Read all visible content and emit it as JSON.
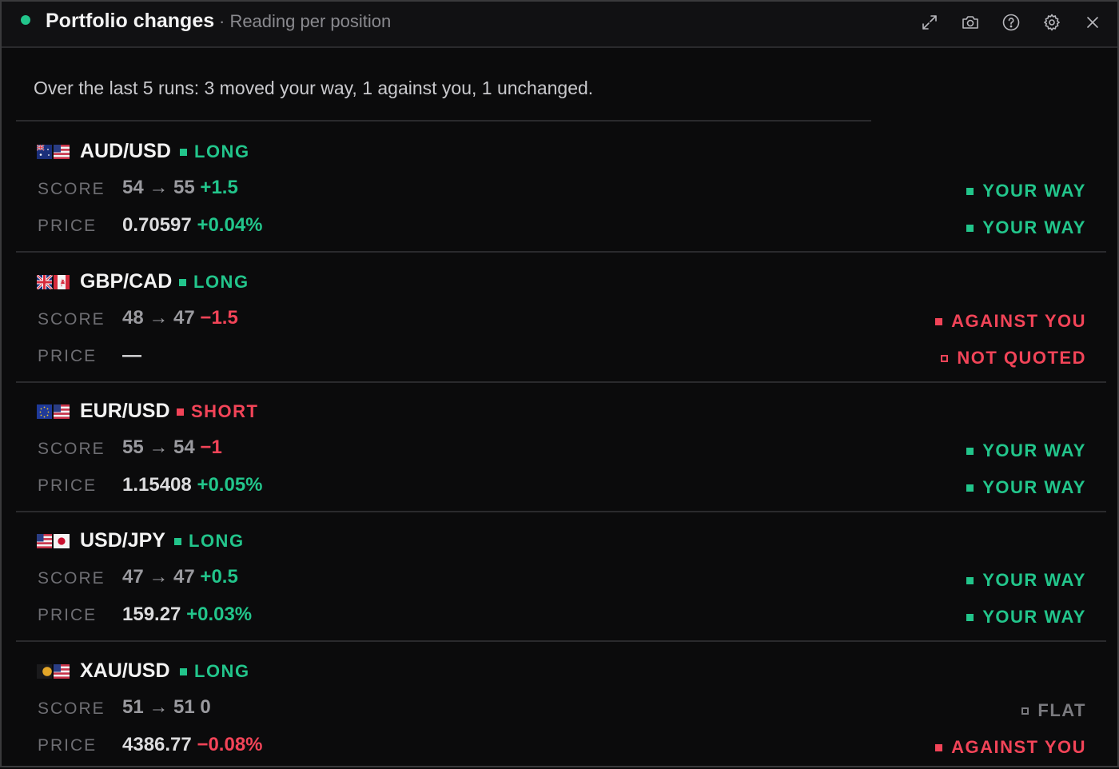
{
  "window": {
    "title": "Portfolio changes",
    "subtitle": "· Reading per position",
    "icons": [
      "expand-icon",
      "camera-icon",
      "help-icon",
      "settings-icon",
      "close-icon"
    ],
    "status_color": "#22c58b"
  },
  "summary": "Over the last 5 runs: 3 moved your way, 1 against you, 1 unchanged.",
  "labels": {
    "score": "SCORE",
    "price": "PRICE"
  },
  "colors": {
    "positive": "#22c58b",
    "negative": "#f24458",
    "neutral": "#7a7a7f"
  },
  "positions": [
    {
      "pair": "AUD/USD",
      "flag": "au-us",
      "direction": "LONG",
      "score": {
        "from": "54",
        "arrow": "→",
        "to": "55",
        "delta": "+1.5"
      },
      "price": {
        "value": "0.70597",
        "change": "+0.04%"
      },
      "verdicts": [
        "YOUR WAY",
        "YOUR WAY"
      ]
    },
    {
      "pair": "GBP/CAD",
      "flag": "gb-ca",
      "direction": "LONG",
      "score": {
        "from": "48",
        "arrow": "→",
        "to": "47",
        "delta": "−1.5"
      },
      "price": {
        "value": "—",
        "change": ""
      },
      "verdicts": [
        "AGAINST YOU",
        "NOT QUOTED"
      ]
    },
    {
      "pair": "EUR/USD",
      "flag": "eu-us",
      "direction": "SHORT",
      "score": {
        "from": "55",
        "arrow": "→",
        "to": "54",
        "delta": "−1"
      },
      "price": {
        "value": "1.15408",
        "change": "+0.05%"
      },
      "verdicts": [
        "YOUR WAY",
        "YOUR WAY"
      ]
    },
    {
      "pair": "USD/JPY",
      "flag": "us-jp",
      "direction": "LONG",
      "score": {
        "from": "47",
        "arrow": "→",
        "to": "47",
        "delta": "+0.5"
      },
      "price": {
        "value": "159.27",
        "change": "+0.03%"
      },
      "verdicts": [
        "YOUR WAY",
        "YOUR WAY"
      ]
    },
    {
      "pair": "XAU/USD",
      "flag": "xau-us",
      "direction": "LONG",
      "score": {
        "from": "51",
        "arrow": "→",
        "to": "51",
        "delta": "0"
      },
      "price": {
        "value": "4386.77",
        "change": "−0.08%"
      },
      "verdicts": [
        "FLAT",
        "AGAINST YOU"
      ]
    }
  ]
}
